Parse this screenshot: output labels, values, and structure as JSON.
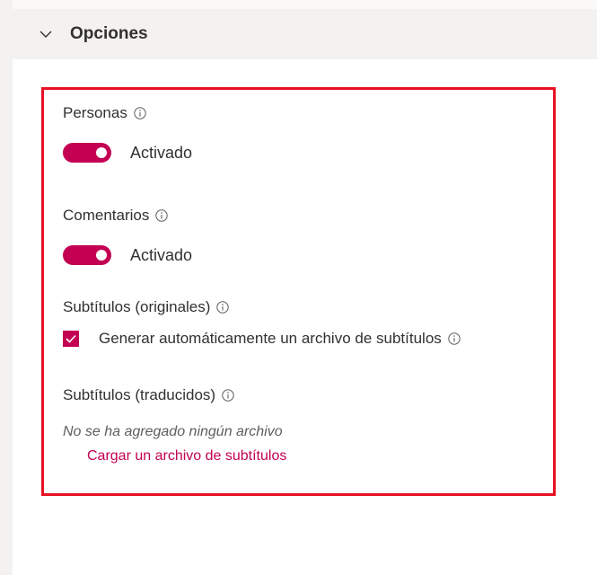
{
  "section": {
    "title": "Opciones",
    "expanded": true
  },
  "personas": {
    "label": "Personas",
    "toggle_state": "Activado",
    "toggle_on": true
  },
  "comentarios": {
    "label": "Comentarios",
    "toggle_state": "Activado",
    "toggle_on": true
  },
  "subtitulos_originales": {
    "label": "Subtítulos (originales)",
    "checkbox_label": "Generar automáticamente un archivo de subtítulos",
    "checked": true
  },
  "subtitulos_traducidos": {
    "label": "Subtítulos (traducidos)",
    "empty_note": "No se ha agregado ningún archivo",
    "upload_link": "Cargar un archivo de subtítulos"
  },
  "colors": {
    "accent": "#c30052",
    "highlight_border": "#e81123",
    "header_bg": "#f3f2f1"
  },
  "icons": {
    "chevron": "chevron-down-icon",
    "info": "info-icon",
    "check": "checkmark-icon"
  }
}
